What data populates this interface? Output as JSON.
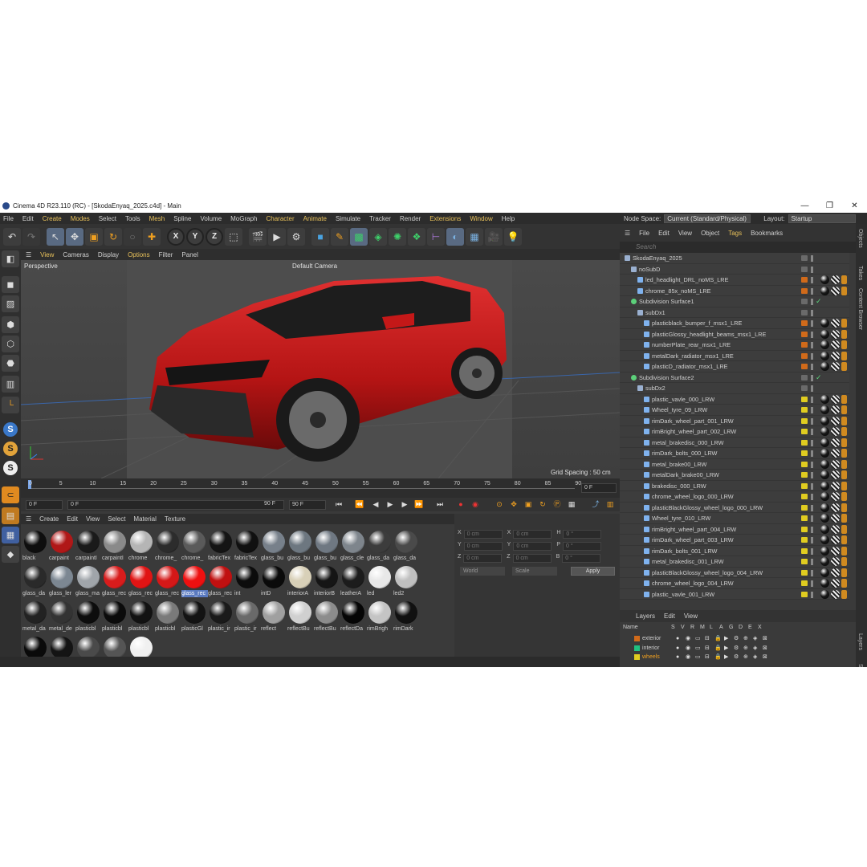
{
  "window": {
    "title": "Cinema 4D R23.110 (RC) - [SkodaEnyaq_2025.c4d] - Main",
    "controls": [
      "—",
      "❐",
      "✕"
    ]
  },
  "menu": [
    "File",
    "Edit",
    "Create",
    "Modes",
    "Select",
    "Tools",
    "Mesh",
    "Spline",
    "Volume",
    "MoGraph",
    "Character",
    "Animate",
    "Simulate",
    "Tracker",
    "Render",
    "Extensions",
    "Window",
    "Help"
  ],
  "node_space": {
    "label": "Node Space:",
    "value": "Current (Standard/Physical)",
    "layout_label": "Layout:",
    "layout_value": "Startup"
  },
  "viewport": {
    "menu": [
      "View",
      "Cameras",
      "Display",
      "Options",
      "Filter",
      "Panel"
    ],
    "name": "Perspective",
    "camera": "Default Camera",
    "grid_spacing": "Grid Spacing : 50 cm"
  },
  "timeline": {
    "ticks": [
      "0",
      "5",
      "10",
      "15",
      "20",
      "25",
      "30",
      "35",
      "40",
      "45",
      "50",
      "55",
      "60",
      "65",
      "70",
      "75",
      "80",
      "85",
      "90"
    ],
    "current": "0 F",
    "start": "0 F",
    "min": "0 F",
    "max": "90 F",
    "end": "90 F"
  },
  "material_manager": {
    "menu": [
      "Create",
      "Edit",
      "View",
      "Select",
      "Material",
      "Texture"
    ],
    "materials": [
      {
        "name": "black",
        "color": "#0e0e0e"
      },
      {
        "name": "carpaint",
        "color": "#b01818"
      },
      {
        "name": "carpaintI",
        "color": "#1a1a1a"
      },
      {
        "name": "carpaintI",
        "color": "#8a8a8a"
      },
      {
        "name": "chrome",
        "color": "#b5b5b5"
      },
      {
        "name": "chrome_",
        "color": "#2c2c2c"
      },
      {
        "name": "chrome_",
        "color": "#5a5a5a"
      },
      {
        "name": "fabricTex",
        "color": "#141414"
      },
      {
        "name": "fabricTex",
        "color": "#101010"
      },
      {
        "name": "glass_bu",
        "color": "#77808a"
      },
      {
        "name": "glass_bu",
        "color": "#6d7780"
      },
      {
        "name": "glass_bu",
        "color": "#6f7882"
      },
      {
        "name": "glass_cle",
        "color": "#7e858c"
      },
      {
        "name": "glass_da",
        "color": "#3c3c3c"
      },
      {
        "name": "glass_da",
        "color": "#4a4a4a"
      },
      {
        "name": "glass_da",
        "color": "#2a2a2a"
      },
      {
        "name": "glass_ler",
        "color": "#7c8792"
      },
      {
        "name": "glass_ma",
        "color": "#a0a5aa"
      },
      {
        "name": "glass_rec",
        "color": "#d81c1c"
      },
      {
        "name": "glass_rec",
        "color": "#e01414"
      },
      {
        "name": "glass_rec",
        "color": "#d41818"
      },
      {
        "name": "glass_rec",
        "color": "#ee1010"
      },
      {
        "name": "glass_rec",
        "color": "#c01010"
      },
      {
        "name": "int",
        "color": "#0c0c0c"
      },
      {
        "name": "intD",
        "color": "#0a0a0a"
      },
      {
        "name": "interiorA",
        "color": "#d8d0b8"
      },
      {
        "name": "interiorB",
        "color": "#151515"
      },
      {
        "name": "leatherA",
        "color": "#1c1c1c"
      },
      {
        "name": "led",
        "color": "#e8e8e8"
      },
      {
        "name": "led2",
        "color": "#bfbfbf"
      },
      {
        "name": "metal_da",
        "color": "#222222"
      },
      {
        "name": "metal_de",
        "color": "#333333"
      },
      {
        "name": "plasticbl",
        "color": "#0d0d0d"
      },
      {
        "name": "plasticbl",
        "color": "#0b0b0b"
      },
      {
        "name": "plasticbl",
        "color": "#121212"
      },
      {
        "name": "plasticbl",
        "color": "#7a7a7a"
      },
      {
        "name": "plasticGl",
        "color": "#131313"
      },
      {
        "name": "plastic_ir",
        "color": "#1a1a1a"
      },
      {
        "name": "plastic_ir",
        "color": "#6a6a6a"
      },
      {
        "name": "reflect",
        "color": "#a0a0a0"
      },
      {
        "name": "reflectBu",
        "color": "#d0d0d0"
      },
      {
        "name": "reflectBu",
        "color": "#8c8c8c"
      },
      {
        "name": "reflectDa",
        "color": "#050505"
      },
      {
        "name": "rimBrigh",
        "color": "#c4c4c4"
      },
      {
        "name": "rimDark",
        "color": "#111111"
      },
      {
        "name": "",
        "color": "#0a0a0a"
      },
      {
        "name": "",
        "color": "#141414"
      },
      {
        "name": "",
        "color": "#4a4a4a"
      },
      {
        "name": "",
        "color": "#555555"
      },
      {
        "name": "",
        "color": "#f0f0f0"
      }
    ],
    "selected_label": "glass_rec"
  },
  "coordinates": {
    "rows": [
      {
        "a": "X",
        "av": "0 cm",
        "b": "X",
        "bv": "0 cm",
        "c": "H",
        "cv": "0 °"
      },
      {
        "a": "Y",
        "av": "0 cm",
        "b": "Y",
        "bv": "0 cm",
        "c": "P",
        "cv": "0 °"
      },
      {
        "a": "Z",
        "av": "0 cm",
        "b": "Z",
        "bv": "0 cm",
        "c": "B",
        "cv": "0 °"
      }
    ],
    "mode": "World",
    "scale": "Scale",
    "apply": "Apply"
  },
  "object_manager": {
    "menu": [
      "File",
      "Edit",
      "View",
      "Object",
      "Tags",
      "Bookmarks"
    ],
    "search_placeholder": "Search",
    "rows": [
      {
        "name": "SkodaEnyaq_2025",
        "indent": 0,
        "type": "null",
        "layer": ""
      },
      {
        "name": "noSubD",
        "indent": 1,
        "type": "null",
        "layer": ""
      },
      {
        "name": "led_headlight_DRL_noMS_LRE",
        "indent": 2,
        "type": "poly",
        "layer": "#d06a1a"
      },
      {
        "name": "chrome_85x_noMS_LRE",
        "indent": 2,
        "type": "poly",
        "layer": "#d06a1a"
      },
      {
        "name": "Subdivision Surface1",
        "indent": 1,
        "type": "sds",
        "layer": ""
      },
      {
        "name": "subDx1",
        "indent": 2,
        "type": "null",
        "layer": ""
      },
      {
        "name": "plasticblack_bumper_f_msx1_LRE",
        "indent": 3,
        "type": "poly",
        "layer": "#d06a1a"
      },
      {
        "name": "plasticGlossy_headlight_beams_msx1_LRE",
        "indent": 3,
        "type": "poly",
        "layer": "#d06a1a"
      },
      {
        "name": "numberPlate_rear_msx1_LRE",
        "indent": 3,
        "type": "poly",
        "layer": "#d06a1a"
      },
      {
        "name": "metalDark_radiator_msx1_LRE",
        "indent": 3,
        "type": "poly",
        "layer": "#d06a1a"
      },
      {
        "name": "plasticD_radiator_msx1_LRE",
        "indent": 3,
        "type": "poly",
        "layer": "#d06a1a"
      },
      {
        "name": "Subdivision Surface2",
        "indent": 1,
        "type": "sds",
        "layer": ""
      },
      {
        "name": "subDx2",
        "indent": 2,
        "type": "null",
        "layer": ""
      },
      {
        "name": "plastic_vavle_000_LRW",
        "indent": 3,
        "type": "poly",
        "layer": "#e0cc20"
      },
      {
        "name": "Wheel_tyre_09_LRW",
        "indent": 3,
        "type": "poly",
        "layer": "#e0cc20"
      },
      {
        "name": "rimDark_wheel_part_001_LRW",
        "indent": 3,
        "type": "poly",
        "layer": "#e0cc20"
      },
      {
        "name": "rimBright_wheel_part_002_LRW",
        "indent": 3,
        "type": "poly",
        "layer": "#e0cc20"
      },
      {
        "name": "metal_brakedisc_000_LRW",
        "indent": 3,
        "type": "poly",
        "layer": "#e0cc20"
      },
      {
        "name": "rimDark_bolts_000_LRW",
        "indent": 3,
        "type": "poly",
        "layer": "#e0cc20"
      },
      {
        "name": "metal_brake00_LRW",
        "indent": 3,
        "type": "poly",
        "layer": "#e0cc20"
      },
      {
        "name": "metalDark_brake00_LRW",
        "indent": 3,
        "type": "poly",
        "layer": "#e0cc20"
      },
      {
        "name": "brakedisc_000_LRW",
        "indent": 3,
        "type": "poly",
        "layer": "#e0cc20"
      },
      {
        "name": "chrome_wheel_logo_000_LRW",
        "indent": 3,
        "type": "poly",
        "layer": "#e0cc20"
      },
      {
        "name": "plasticBlackGlossy_wheel_logo_000_LRW",
        "indent": 3,
        "type": "poly",
        "layer": "#e0cc20"
      },
      {
        "name": "Wheel_tyre_010_LRW",
        "indent": 3,
        "type": "poly",
        "layer": "#e0cc20"
      },
      {
        "name": "rimBright_wheel_part_004_LRW",
        "indent": 3,
        "type": "poly",
        "layer": "#e0cc20"
      },
      {
        "name": "rimDark_wheel_part_003_LRW",
        "indent": 3,
        "type": "poly",
        "layer": "#e0cc20"
      },
      {
        "name": "rimDark_bolts_001_LRW",
        "indent": 3,
        "type": "poly",
        "layer": "#e0cc20"
      },
      {
        "name": "metal_brakedisc_001_LRW",
        "indent": 3,
        "type": "poly",
        "layer": "#e0cc20"
      },
      {
        "name": "plasticBlackGlossy_wheel_logo_004_LRW",
        "indent": 3,
        "type": "poly",
        "layer": "#e0cc20"
      },
      {
        "name": "chrome_wheel_logo_004_LRW",
        "indent": 3,
        "type": "poly",
        "layer": "#e0cc20"
      },
      {
        "name": "plastic_vavle_001_LRW",
        "indent": 3,
        "type": "poly",
        "layer": "#e0cc20"
      }
    ]
  },
  "layers": {
    "menu": [
      "Layers",
      "Edit",
      "View"
    ],
    "header": [
      "Name",
      "S",
      "V",
      "R",
      "M",
      "L",
      "A",
      "G",
      "D",
      "E",
      "X"
    ],
    "rows": [
      {
        "name": "exterior",
        "color": "#d06a1a",
        "highlight": false
      },
      {
        "name": "interior",
        "color": "#20c080",
        "highlight": false
      },
      {
        "name": "wheels",
        "color": "#e0cc20",
        "highlight": true
      }
    ]
  },
  "right_tabs": [
    "Objects",
    "Takes",
    "Content Browser",
    "Layers",
    "Str"
  ]
}
